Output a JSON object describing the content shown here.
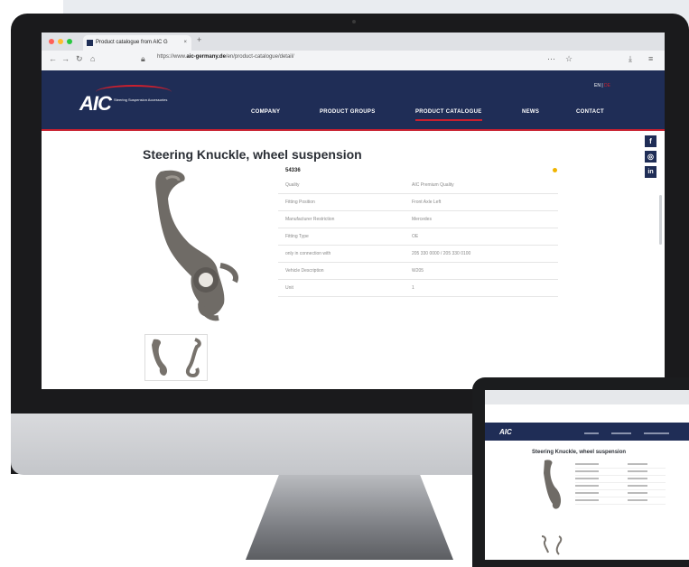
{
  "browser": {
    "tab_title": "Product catalogue from AIC G",
    "url_prefix": "https://www.",
    "url_domain": "aic-germany.de",
    "url_suffix": "/en/product-catalogue/detail/",
    "tab_close": "×",
    "new_tab": "+"
  },
  "site": {
    "logo": "AIC",
    "logo_sub": "Steering Suspension Accessories",
    "lang": "EN",
    "lang_alt": "DE",
    "menu": [
      "COMPANY",
      "PRODUCT GROUPS",
      "PRODUCT CATALOGUE",
      "NEWS",
      "CONTACT"
    ],
    "active_menu": "PRODUCT CATALOGUE"
  },
  "product": {
    "title": "Steering Knuckle, wheel suspension",
    "article": "54336",
    "specs": [
      {
        "label": "Quality",
        "value": "AIC Premium Quality"
      },
      {
        "label": "Fitting Position",
        "value": "Front Axle Left"
      },
      {
        "label": "Manufacturer Restriction",
        "value": "Mercedes"
      },
      {
        "label": "Fitting Type",
        "value": "OE"
      },
      {
        "label": "only in connection with",
        "value": "205 330 0000 / 205 330 0100"
      },
      {
        "label": "Vehicle Description",
        "value": "W205"
      },
      {
        "label": "Unit",
        "value": "1"
      }
    ]
  },
  "social": [
    "f",
    "◎",
    "in"
  ],
  "tablet": {
    "logo": "AIC",
    "title": "Steering Knuckle, wheel suspension"
  },
  "colors": {
    "navy": "#1f2d56",
    "accent_red": "#c8202f",
    "star": "#f0b400"
  }
}
